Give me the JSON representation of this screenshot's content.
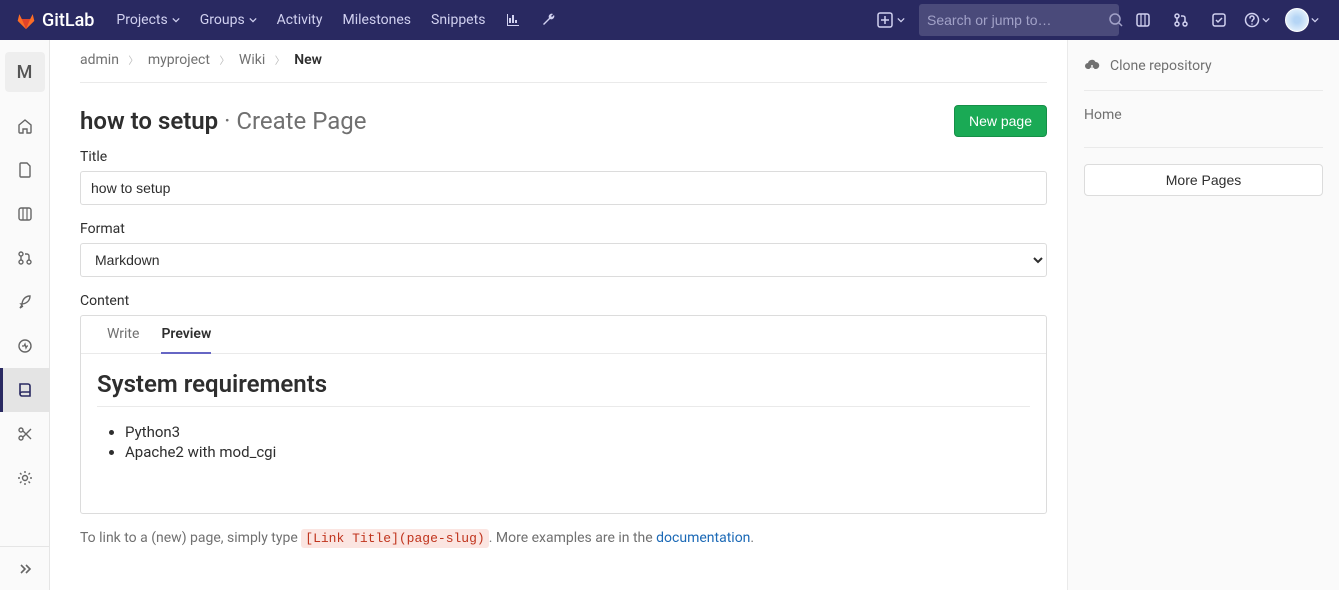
{
  "nav": {
    "brand": "GitLab",
    "items": [
      "Projects",
      "Groups",
      "Activity",
      "Milestones",
      "Snippets"
    ],
    "search_placeholder": "Search or jump to…"
  },
  "sidebar": {
    "project_initial": "M"
  },
  "breadcrumbs": {
    "a": "admin",
    "b": "myproject",
    "c": "Wiki",
    "d": "New"
  },
  "page": {
    "title_strong": "how to setup",
    "title_rest": "· Create Page",
    "new_page_btn": "New page"
  },
  "form": {
    "title_label": "Title",
    "title_value": "how to setup",
    "format_label": "Format",
    "format_value": "Markdown",
    "content_label": "Content",
    "tab_write": "Write",
    "tab_preview": "Preview"
  },
  "preview": {
    "heading": "System requirements",
    "items": [
      "Python3",
      "Apache2 with mod_cgi"
    ]
  },
  "hint": {
    "pre": "To link to a (new) page, simply type ",
    "code": "[Link Title](page-slug)",
    "mid": ". More examples are in the ",
    "link": "documentation",
    "post": "."
  },
  "right": {
    "clone": "Clone repository",
    "home": "Home",
    "more": "More Pages"
  }
}
